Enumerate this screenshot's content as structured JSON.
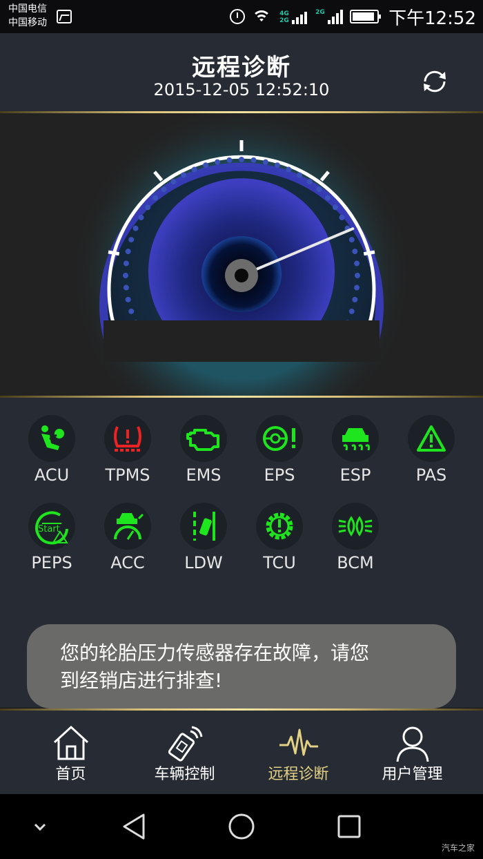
{
  "status_bar": {
    "carrier_1": "中国电信",
    "carrier_2": "中国移动",
    "network_1": "4G",
    "network_2": "2G",
    "network_3": "2G",
    "time": "下午12:52",
    "battery_level": 0.9
  },
  "header": {
    "title": "远程诊断",
    "datetime": "2015-12-05 12:52:10",
    "refresh_icon": "refresh-icon"
  },
  "gauge": {
    "needle_level": 0.78
  },
  "modules": [
    {
      "label": "ACU",
      "icon": "airbag-icon",
      "color": "#1fe51f"
    },
    {
      "label": "TPMS",
      "icon": "tire-pressure-icon",
      "color": "#ee2222"
    },
    {
      "label": "EMS",
      "icon": "engine-icon",
      "color": "#1fe51f"
    },
    {
      "label": "EPS",
      "icon": "steering-warning-icon",
      "color": "#1fe51f"
    },
    {
      "label": "ESP",
      "icon": "stability-control-icon",
      "color": "#1fe51f"
    },
    {
      "label": "PAS",
      "icon": "warning-triangle-icon",
      "color": "#1fe51f"
    },
    {
      "label": "PEPS",
      "icon": "start-button-icon",
      "color": "#1fe51f"
    },
    {
      "label": "ACC",
      "icon": "cruise-control-icon",
      "color": "#1fe51f"
    },
    {
      "label": "LDW",
      "icon": "lane-departure-icon",
      "color": "#1fe51f"
    },
    {
      "label": "TCU",
      "icon": "transmission-warning-icon",
      "color": "#1fe51f"
    },
    {
      "label": "BCM",
      "icon": "lights-icon",
      "color": "#1fe51f"
    }
  ],
  "toast": {
    "line_1": "您的轮胎压力传感器存在故障，请您",
    "line_2": "到经销店进行排查!"
  },
  "bottom_nav": [
    {
      "label": "首页",
      "icon": "home-icon"
    },
    {
      "label": "车辆控制",
      "icon": "car-key-icon"
    },
    {
      "label": "远程诊断",
      "icon": "heartbeat-icon",
      "active": true
    },
    {
      "label": "用户管理",
      "icon": "user-icon"
    }
  ],
  "colors": {
    "accent_gold": "#e3d184",
    "ok_green": "#1fe51f",
    "fault_red": "#ee2222",
    "panel_bg": "#272b34"
  },
  "watermark": "汽车之家"
}
